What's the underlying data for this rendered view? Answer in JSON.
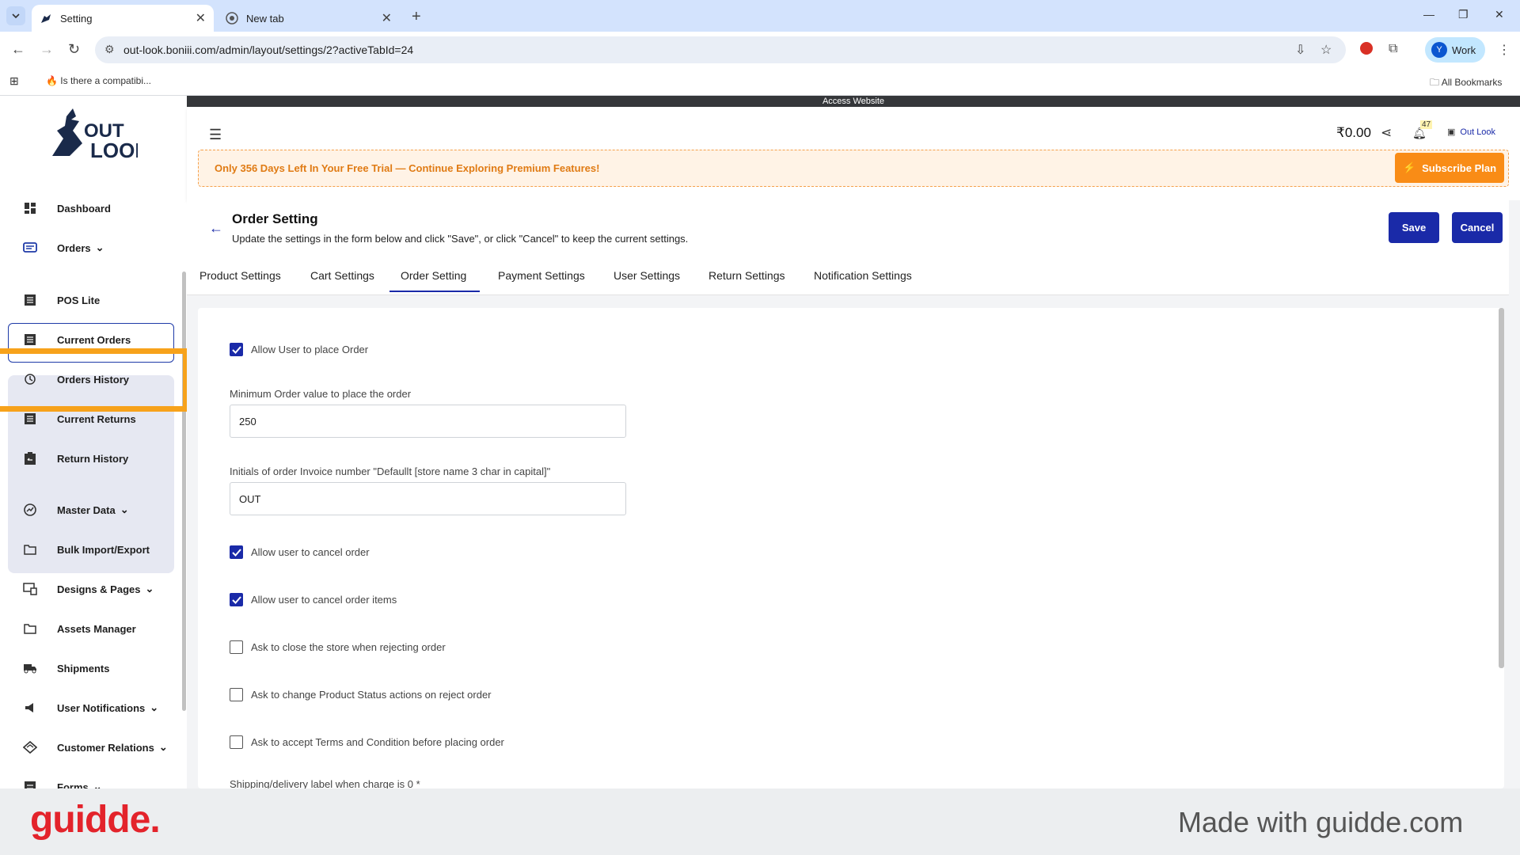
{
  "browser": {
    "tabs": [
      {
        "title": "Setting",
        "icon": "outlook-favicon"
      },
      {
        "title": "New tab",
        "icon": "chrome-icon"
      }
    ],
    "url": "out-look.boniii.com/admin/layout/settings/2?activeTabId=24",
    "profile": {
      "initial": "Y",
      "label": "Work"
    },
    "bookmark_item": "Is there a compatibi...",
    "all_bookmarks": "All Bookmarks"
  },
  "app": {
    "access_bar": "Access Website",
    "balance": "₹0.00",
    "notification_count": "47",
    "store_name": "Out Look",
    "trial_text": "Only 356 Days Left In Your Free Trial — Continue Exploring Premium Features!",
    "subscribe_label": "Subscribe Plan"
  },
  "sidebar": {
    "logo_text": "OUT LOOK",
    "items": [
      {
        "label": "Dashboard",
        "icon": "dashboard-icon"
      },
      {
        "label": "Orders",
        "icon": "orders-icon"
      },
      {
        "label": "POS Lite",
        "icon": "list-icon"
      },
      {
        "label": "Current Orders",
        "icon": "list-icon"
      },
      {
        "label": "Orders History",
        "icon": "history-icon"
      },
      {
        "label": "Current Returns",
        "icon": "list-icon"
      },
      {
        "label": "Return History",
        "icon": "return-icon"
      },
      {
        "label": "Master Data",
        "icon": "gauge-icon"
      },
      {
        "label": "Bulk Import/Export",
        "icon": "folder-icon"
      },
      {
        "label": "Designs & Pages",
        "icon": "design-icon"
      },
      {
        "label": "Assets Manager",
        "icon": "folder-icon"
      },
      {
        "label": "Shipments",
        "icon": "truck-icon"
      },
      {
        "label": "User Notifications",
        "icon": "megaphone-icon"
      },
      {
        "label": "Customer Relations",
        "icon": "handshake-icon"
      },
      {
        "label": "Forms",
        "icon": "form-icon"
      }
    ]
  },
  "page": {
    "title": "Order Setting",
    "description": "Update the settings in the form below and click \"Save\", or click \"Cancel\" to keep the current settings.",
    "save_label": "Save",
    "cancel_label": "Cancel",
    "tabs": [
      "Product Settings",
      "Cart Settings",
      "Order Setting",
      "Payment Settings",
      "User Settings",
      "Return Settings",
      "Notification Settings"
    ],
    "active_tab": "Order Setting"
  },
  "form": {
    "allow_place_order": {
      "label": "Allow User to place Order",
      "checked": true
    },
    "min_order": {
      "label": "Minimum Order value to place the order",
      "value": "250"
    },
    "invoice_initials": {
      "label": "Initials of order Invoice number \"Defaullt [store name 3 char in capital]\"",
      "value": "OUT"
    },
    "allow_cancel_order": {
      "label": "Allow user to cancel order",
      "checked": true
    },
    "allow_cancel_items": {
      "label": "Allow user to cancel order items",
      "checked": true
    },
    "close_store": {
      "label": "Ask to close the store when rejecting order",
      "checked": false
    },
    "change_status": {
      "label": "Ask to change Product Status actions on reject order",
      "checked": false
    },
    "accept_terms": {
      "label": "Ask to accept Terms and Condition before placing order",
      "checked": false
    },
    "shipping_label": {
      "label": "Shipping/delivery label when charge is 0 *"
    }
  },
  "footer": {
    "brand": "guidde.",
    "made_with": "Made with guidde.com"
  },
  "colors": {
    "primary": "#1a2aa8",
    "trial_orange": "#f98c16",
    "highlight": "#f7a21b",
    "guidde_red": "#e3232b"
  }
}
